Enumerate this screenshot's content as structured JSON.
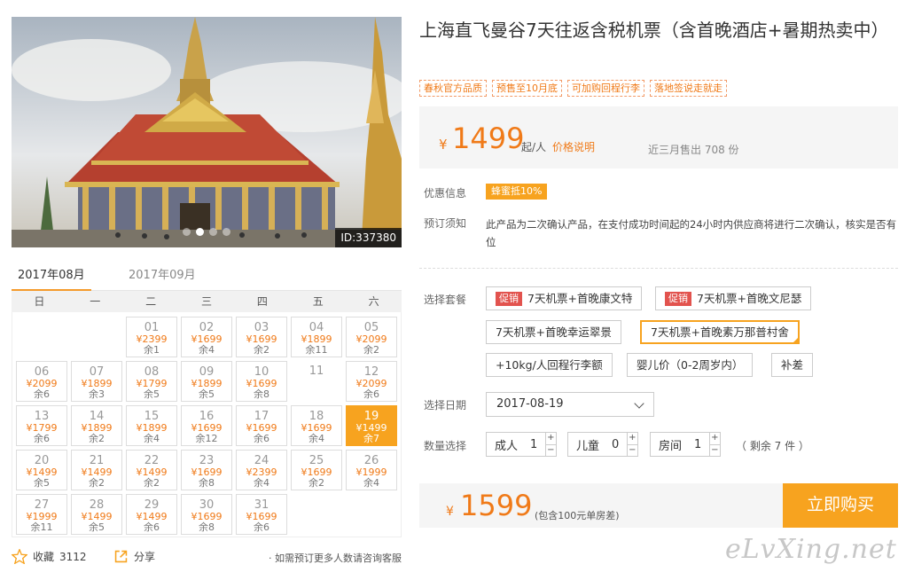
{
  "photo": {
    "id_label": "ID:337380",
    "slide_count": 4,
    "active_slide": 1
  },
  "calendar": {
    "tabs": [
      "2017年08月",
      "2017年09月"
    ],
    "active_tab": 0,
    "weekdays": [
      "日",
      "一",
      "二",
      "三",
      "四",
      "五",
      "六"
    ],
    "days": [
      {
        "day": "01",
        "price": "¥2399",
        "left": "余1"
      },
      {
        "day": "02",
        "price": "¥1699",
        "left": "余4"
      },
      {
        "day": "03",
        "price": "¥1699",
        "left": "余2"
      },
      {
        "day": "04",
        "price": "¥1899",
        "left": "余11"
      },
      {
        "day": "05",
        "price": "¥2099",
        "left": "余2"
      },
      {
        "day": "06",
        "price": "¥2099",
        "left": "余6"
      },
      {
        "day": "07",
        "price": "¥1899",
        "left": "余3"
      },
      {
        "day": "08",
        "price": "¥1799",
        "left": "余5"
      },
      {
        "day": "09",
        "price": "¥1899",
        "left": "余5"
      },
      {
        "day": "10",
        "price": "¥1699",
        "left": "余8"
      },
      {
        "day": "11",
        "price": "",
        "left": ""
      },
      {
        "day": "12",
        "price": "¥2099",
        "left": "余6"
      },
      {
        "day": "13",
        "price": "¥1799",
        "left": "余6"
      },
      {
        "day": "14",
        "price": "¥1899",
        "left": "余2"
      },
      {
        "day": "15",
        "price": "¥1899",
        "left": "余4"
      },
      {
        "day": "16",
        "price": "¥1699",
        "left": "余12"
      },
      {
        "day": "17",
        "price": "¥1699",
        "left": "余6"
      },
      {
        "day": "18",
        "price": "¥1699",
        "left": "余4"
      },
      {
        "day": "19",
        "price": "¥1499",
        "left": "余7"
      },
      {
        "day": "20",
        "price": "¥1499",
        "left": "余5"
      },
      {
        "day": "21",
        "price": "¥1499",
        "left": "余2"
      },
      {
        "day": "22",
        "price": "¥1499",
        "left": "余2"
      },
      {
        "day": "23",
        "price": "¥1699",
        "left": "余8"
      },
      {
        "day": "24",
        "price": "¥2399",
        "left": "余4"
      },
      {
        "day": "25",
        "price": "¥1699",
        "left": "余2"
      },
      {
        "day": "26",
        "price": "¥1999",
        "left": "余4"
      },
      {
        "day": "27",
        "price": "¥1999",
        "left": "余11"
      },
      {
        "day": "28",
        "price": "¥1499",
        "left": "余5"
      },
      {
        "day": "29",
        "price": "¥1499",
        "left": "余6"
      },
      {
        "day": "30",
        "price": "¥1699",
        "left": "余8"
      },
      {
        "day": "31",
        "price": "¥1699",
        "left": "余6"
      }
    ],
    "selected_day": "19"
  },
  "actions": {
    "favorite_label": "收藏",
    "favorite_count": "3112",
    "share_label": "分享",
    "hint": "· 如需预订更多人数请咨询客服"
  },
  "product": {
    "title": "上海直飞曼谷7天往返含税机票（含首晚酒店+暑期热卖中）",
    "tags": [
      "春秋官方品质",
      "预售至10月底",
      "可加购回程行李",
      "落地签说走就走"
    ]
  },
  "price": {
    "currency": "¥",
    "amount": "1499",
    "unit": "起/人",
    "explain_link": "价格说明",
    "sold": "近三月售出 708 份"
  },
  "offers": {
    "label": "优惠信息",
    "badge": "蜂蜜抵10%"
  },
  "notice": {
    "label": "预订须知",
    "text": "此产品为二次确认产品，在支付成功时间起的24小时内供应商将进行二次确认，核实是否有位"
  },
  "packages": {
    "label": "选择套餐",
    "flag_text": "促销",
    "items": [
      {
        "name": "7天机票+首晚康文特",
        "promo": true
      },
      {
        "name": "7天机票+首晚文尼瑟",
        "promo": true
      },
      {
        "name": "7天机票+首晚幸运翠景",
        "promo": false
      },
      {
        "name": "7天机票+首晚素万那普村舍",
        "promo": false,
        "selected": true
      },
      {
        "name": "+10kg/人回程行李额",
        "promo": false
      },
      {
        "name": "婴儿价（0-2周岁内）",
        "promo": false
      },
      {
        "name": "补差",
        "promo": false
      }
    ]
  },
  "date": {
    "label": "选择日期",
    "value": "2017-08-19"
  },
  "quantity": {
    "label": "数量选择",
    "adult_label": "成人",
    "adult_value": "1",
    "child_label": "儿童",
    "child_value": "0",
    "room_label": "房间",
    "room_value": "1",
    "plus": "+",
    "minus": "−",
    "remain": "（ 剩余 7 件 ）"
  },
  "total": {
    "currency": "¥",
    "amount": "1599",
    "note": "(包含100元单房差)",
    "buy_label": "立即购买"
  },
  "watermark": "eLvXing.net",
  "colors": {
    "accent": "#f7a31f",
    "price": "#f07a18",
    "promo_flag": "#e2534e"
  }
}
